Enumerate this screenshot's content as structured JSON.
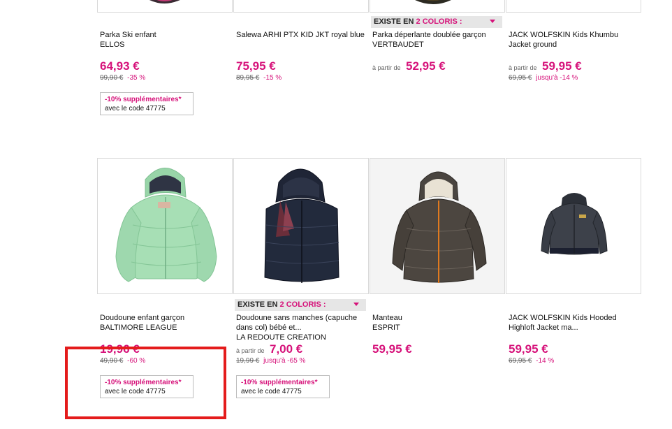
{
  "top_row": [
    {
      "title": "Parka Ski enfant",
      "brand": "ELLOS",
      "price": "64,93 €",
      "old_price": "99,90 €",
      "discount": "-35 %",
      "promo": {
        "line1": "-10% supplémentaires*",
        "line2": "avec le code 47775"
      }
    },
    {
      "title": "Salewa ARHI PTX KID JKT royal blue",
      "brand": "",
      "price": "75,95 €",
      "old_price": "89,95 €",
      "discount": "-15 %"
    },
    {
      "colors_label": "EXISTE EN",
      "colors_count": "2 COLORIS :",
      "title": "Parka déperlante doublée garçon",
      "brand": "VERTBAUDET",
      "from_label": "à partir de",
      "price": "52,95 €"
    },
    {
      "title": "JACK WOLFSKIN Kids Khumbu Jacket ground",
      "brand": "",
      "from_label": "à partir de",
      "price": "59,95 €",
      "old_price": "69,95 €",
      "discount": "jusqu'à -14 %"
    }
  ],
  "bottom_row": [
    {
      "image": "mint-puffer-jacket",
      "title": "Doudoune enfant garçon",
      "brand": "BALTIMORE LEAGUE",
      "price": "19,96 €",
      "old_price": "49,90 €",
      "discount": "-60 %",
      "promo": {
        "line1": "-10% supplémentaires*",
        "line2": "avec le code 47775"
      }
    },
    {
      "image": "navy-puffer-vest",
      "colors_label": "EXISTE EN",
      "colors_count": "2 COLORIS :",
      "title": "Doudoune sans manches (capuche dans col) bébé et...",
      "brand": "LA REDOUTE CREATION",
      "from_label": "à partir de",
      "price": "7,00 €",
      "old_price": "19,99 €",
      "discount": "jusqu'à -65 %",
      "promo": {
        "line1": "-10% supplémentaires*",
        "line2": "avec le code 47775"
      }
    },
    {
      "image": "brown-puffer-jacket",
      "title": "Manteau",
      "brand": "ESPRIT",
      "price": "59,95 €"
    },
    {
      "image": "charcoal-fleece-jacket",
      "title": "JACK WOLFSKIN Kids Hooded Highloft Jacket ma...",
      "brand": "",
      "price": "59,95 €",
      "old_price": "69,95 €",
      "discount": "-14 %"
    }
  ],
  "colors": {
    "accent": "#d6127a",
    "highlight": "#e41b1b",
    "border": "#d9d9d9"
  }
}
